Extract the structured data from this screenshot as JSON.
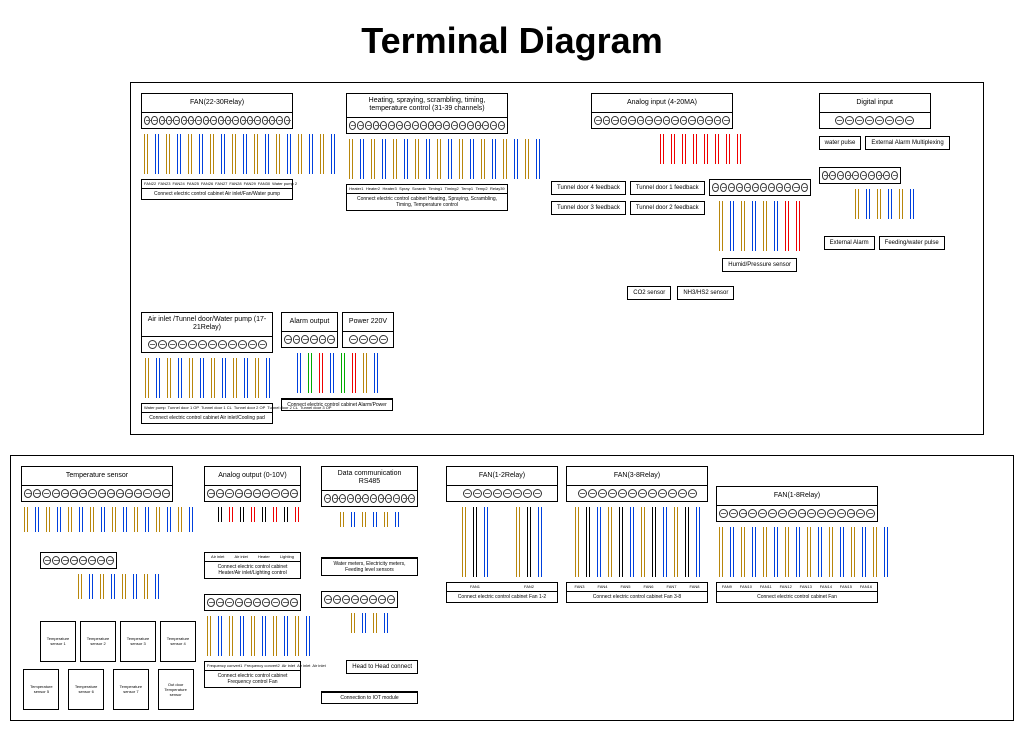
{
  "title": "Terminal Diagram",
  "panel1": {
    "row1": {
      "mod1": {
        "title": "FAN(22-30Relay)",
        "caption": "Connect electric control cabinet Air inlet/Fan/Water pump",
        "terminals": 10,
        "labels": [
          "FAN22",
          "FAN23",
          "FAN24",
          "FAN25",
          "FAN26",
          "FAN27",
          "FAN28",
          "FAN29",
          "FAN30",
          "Water pump 2"
        ]
      },
      "mod2": {
        "title": "Heating, spraying, scrambling, timing, temperature control (31-39 channels)",
        "caption": "Connect electric control cabinet Heating, Spraying, Scrambling, Timing, Temperature control",
        "terminals": 10,
        "labels": [
          "Heater1",
          "Heater2",
          "Heater3",
          "Spray",
          "Scramb",
          "Timing1",
          "Timing2",
          "Temp1",
          "Temp2",
          "Relay39"
        ]
      },
      "mod3": {
        "title": "Analog input (4-20MA)",
        "terminals": 8,
        "side_labels": [
          "Tunnel door 1 feedback",
          "Tunnel door 2 feedback",
          "Tunnel door 3 feedback",
          "Tunnel door 4 feedback"
        ],
        "sensors": [
          "CO2 sensor",
          "NH3/HS2 sensor",
          "Humid/Pressure sensor"
        ]
      },
      "mod4": {
        "title": "Digital input",
        "terminals": 4,
        "labels": [
          "water pulse",
          "External Alarm Multiplexing"
        ],
        "sub_terminals": 5,
        "sub_labels": [
          "External Alarm",
          "Feeding/water pulse"
        ]
      }
    },
    "row2": {
      "mod1": {
        "title": "Air inlet /Tunnel door/Water pump (17-21Relay)",
        "caption": "Connect electric control cabinet Air inlet/Cooling pad",
        "terminals": 6,
        "labels": [
          "Water pump",
          "Tunnel door 1 OP",
          "Tunnel door 1 CL",
          "Tunnel door 2 OP",
          "Tunnel door 2 CL",
          "Tunnel door 3 OP"
        ]
      },
      "mod2": {
        "title": "Alarm output",
        "terminals": 3,
        "caption": "Connect electric control cabinet Alarm/Power"
      },
      "mod3": {
        "title": "Power 220V",
        "terminals": 2
      }
    }
  },
  "panel2": {
    "mod1": {
      "title": "Temperature sensor",
      "terminals": 8,
      "sub_terminals": 4,
      "sensors_top": [
        "Temperature sensor 1",
        "Temperature sensor 2",
        "Temperature sensor 3",
        "Temperature sensor 4"
      ],
      "sensors_bottom": [
        "Temperature sensor 5",
        "Temperature sensor 6",
        "Temperature sensor 7",
        "Out door Temperature sensor"
      ]
    },
    "mod2": {
      "title": "Analog output (0-10V)",
      "terminals": 5,
      "labels": [
        "Air inlet",
        "Air inlet",
        "Heater",
        "Lighting",
        ""
      ],
      "caption": "Connect electric control cabinet Heater/Air inlet/Lighting control",
      "sub_terminals": 5,
      "sub_labels": [
        "Frequency convert1",
        "Frequency convert2",
        "Air inlet",
        "Air inlet",
        "Air inlet"
      ],
      "sub_caption": "Connect electric control cabinet Frequency control Fan"
    },
    "mod3": {
      "title": "Data communication RS485",
      "terminals": 6,
      "caption": "Water meters, Electricity meters, Feeding level sensors",
      "sub_terminals": 4,
      "sub_caption1": "Head to Head connect",
      "sub_caption2": "Connection to IOT module"
    },
    "mod4": {
      "title": "FAN(1-2Relay)",
      "terminals": 4,
      "labels": [
        "FAN1",
        "",
        "FAN2",
        ""
      ],
      "caption": "Connect electric control cabinet Fan 1-2"
    },
    "mod5": {
      "title": "FAN(3-8Relay)",
      "terminals": 6,
      "labels": [
        "FAN3",
        "FAN4",
        "FAN5",
        "FAN6",
        "FAN7",
        "FAN8"
      ],
      "caption": "Connect electric control cabinet Fan 3-8"
    },
    "mod6": {
      "title": "FAN(1-8Relay)",
      "terminals": 8,
      "labels": [
        "FAN9",
        "FAN10",
        "FAN11",
        "FAN12",
        "FAN13",
        "FAN14",
        "FAN15",
        "FAN16"
      ],
      "caption": "Connect electric control cabinet Fan"
    }
  }
}
